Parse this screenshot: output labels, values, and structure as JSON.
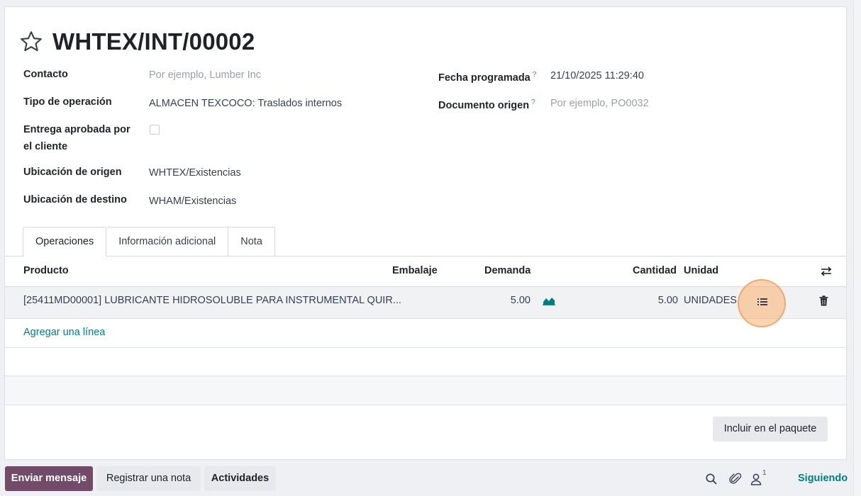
{
  "record": {
    "title": "WHTEX/INT/00002"
  },
  "fields": {
    "contacto_label": "Contacto",
    "contacto_placeholder": "Por ejemplo, Lumber Inc",
    "tipo_label": "Tipo de operación",
    "tipo_value": "ALMACEN TEXCOCO: Traslados internos",
    "entrega_label_line1": "Entrega aprobada por",
    "entrega_label_line2": "el cliente",
    "origen_label": "Ubicación de origen",
    "origen_value": "WHTEX/Existencias",
    "destino_label": "Ubicación de destino",
    "destino_value": "WHAM/Existencias",
    "fecha_label": "Fecha programada",
    "fecha_value": "21/10/2025 11:29:40",
    "documento_label": "Documento origen",
    "documento_placeholder": "Por ejemplo, PO0032",
    "help_mark": "?"
  },
  "tabs": [
    {
      "label": "Operaciones"
    },
    {
      "label": "Información adicional"
    },
    {
      "label": "Nota"
    }
  ],
  "table": {
    "headers": {
      "producto": "Producto",
      "embalaje": "Embalaje",
      "demanda": "Demanda",
      "cantidad": "Cantidad",
      "unidad": "Unidad"
    },
    "rows": [
      {
        "producto": "[25411MD00001] LUBRICANTE HIDROSOLUBLE PARA INSTRUMENTAL QUIR...",
        "demanda": "5.00",
        "cantidad": "5.00",
        "unidad": "UNIDADES"
      }
    ],
    "add_line": "Agregar una línea"
  },
  "buttons": {
    "incluir_paquete": "Incluir en el paquete",
    "enviar_mensaje": "Enviar mensaje",
    "registrar_nota": "Registrar una nota",
    "actividades": "Actividades",
    "siguiendo": "Siguiendo"
  },
  "chatter": {
    "followers_count": "1"
  },
  "colors": {
    "accent": "#017e84",
    "primary": "#714b67",
    "highlight": "#f7a35c"
  },
  "icons": [
    "star-icon",
    "forecast-chart-icon",
    "detailed-operations-icon",
    "trash-icon",
    "optional-columns-icon",
    "search-icon",
    "paperclip-icon",
    "followers-icon"
  ]
}
